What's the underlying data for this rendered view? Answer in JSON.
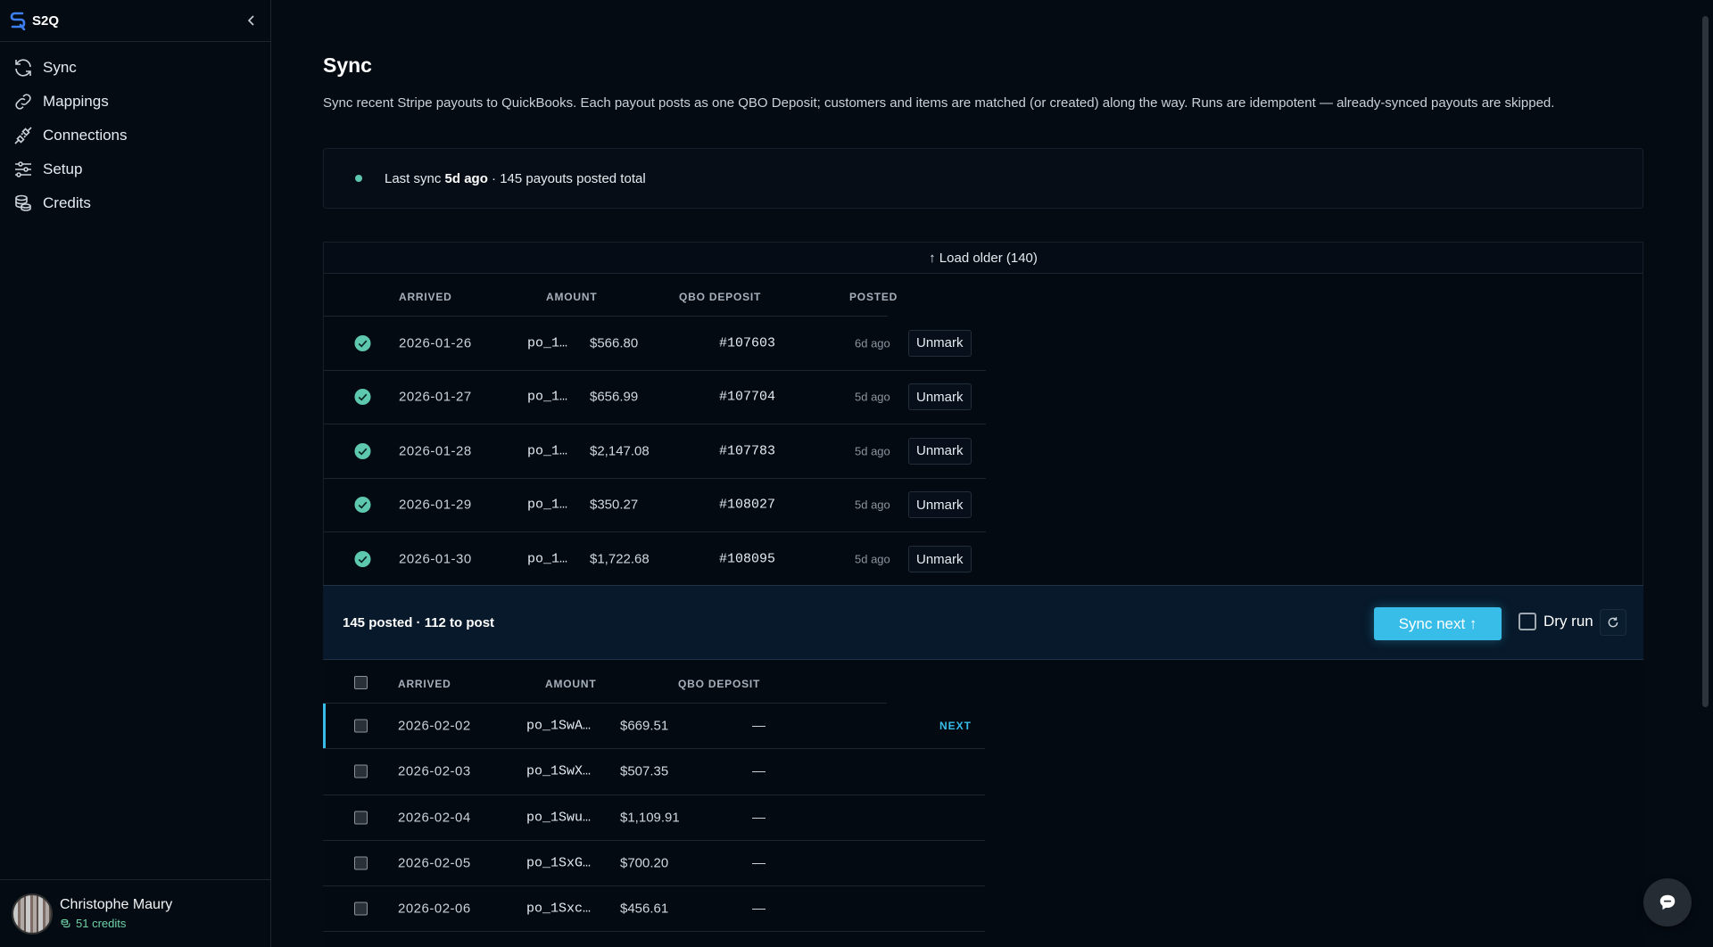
{
  "app": {
    "name": "S2Q"
  },
  "sidebar": {
    "items": [
      {
        "label": "Sync",
        "icon": "sync-icon"
      },
      {
        "label": "Mappings",
        "icon": "link-icon"
      },
      {
        "label": "Connections",
        "icon": "plug-icon"
      },
      {
        "label": "Setup",
        "icon": "sliders-icon"
      },
      {
        "label": "Credits",
        "icon": "coins-icon"
      }
    ],
    "user": {
      "name": "Christophe Maury",
      "credits": "51 credits"
    }
  },
  "page": {
    "title": "Sync",
    "description": "Sync recent Stripe payouts to QuickBooks. Each payout posts as one QBO Deposit; customers and items are matched (or created) along the way. Runs are idempotent — already-synced payouts are skipped."
  },
  "status": {
    "prefix": "Last sync ",
    "when": "5d ago",
    "suffix": " · 145 payouts posted total"
  },
  "posted": {
    "load_older": "↑ Load older (140)",
    "headers": {
      "arrived": "ARRIVED",
      "amount": "AMOUNT",
      "qbo_deposit": "QBO DEPOSIT",
      "posted": "POSTED"
    },
    "rows": [
      {
        "arrived": "2026-01-26",
        "payout": "po_1…",
        "amount": "$566.80",
        "deposit": "#107603",
        "posted": "6d ago",
        "action": "Unmark"
      },
      {
        "arrived": "2026-01-27",
        "payout": "po_1…",
        "amount": "$656.99",
        "deposit": "#107704",
        "posted": "5d ago",
        "action": "Unmark"
      },
      {
        "arrived": "2026-01-28",
        "payout": "po_1…",
        "amount": "$2,147.08",
        "deposit": "#107783",
        "posted": "5d ago",
        "action": "Unmark"
      },
      {
        "arrived": "2026-01-29",
        "payout": "po_1…",
        "amount": "$350.27",
        "deposit": "#108027",
        "posted": "5d ago",
        "action": "Unmark"
      },
      {
        "arrived": "2026-01-30",
        "payout": "po_1…",
        "amount": "$1,722.68",
        "deposit": "#108095",
        "posted": "5d ago",
        "action": "Unmark"
      }
    ]
  },
  "actions": {
    "summary": "145 posted · 112 to post",
    "sync_next": "Sync next ↑",
    "dry_run": "Dry run"
  },
  "queue": {
    "headers": {
      "arrived": "ARRIVED",
      "amount": "AMOUNT",
      "qbo_deposit": "QBO DEPOSIT"
    },
    "rows": [
      {
        "arrived": "2026-02-02",
        "payout": "po_1SwA…",
        "amount": "$669.51",
        "deposit": "—",
        "tag": "NEXT"
      },
      {
        "arrived": "2026-02-03",
        "payout": "po_1SwX…",
        "amount": "$507.35",
        "deposit": "—",
        "tag": ""
      },
      {
        "arrived": "2026-02-04",
        "payout": "po_1Swu…",
        "amount": "$1,109.91",
        "deposit": "—",
        "tag": ""
      },
      {
        "arrived": "2026-02-05",
        "payout": "po_1SxG…",
        "amount": "$700.20",
        "deposit": "—",
        "tag": ""
      },
      {
        "arrived": "2026-02-06",
        "payout": "po_1Sxc…",
        "amount": "$456.61",
        "deposit": "—",
        "tag": ""
      }
    ]
  },
  "colors": {
    "accent": "#38bde8",
    "success": "#5ec8ae",
    "background": "#050b13"
  }
}
